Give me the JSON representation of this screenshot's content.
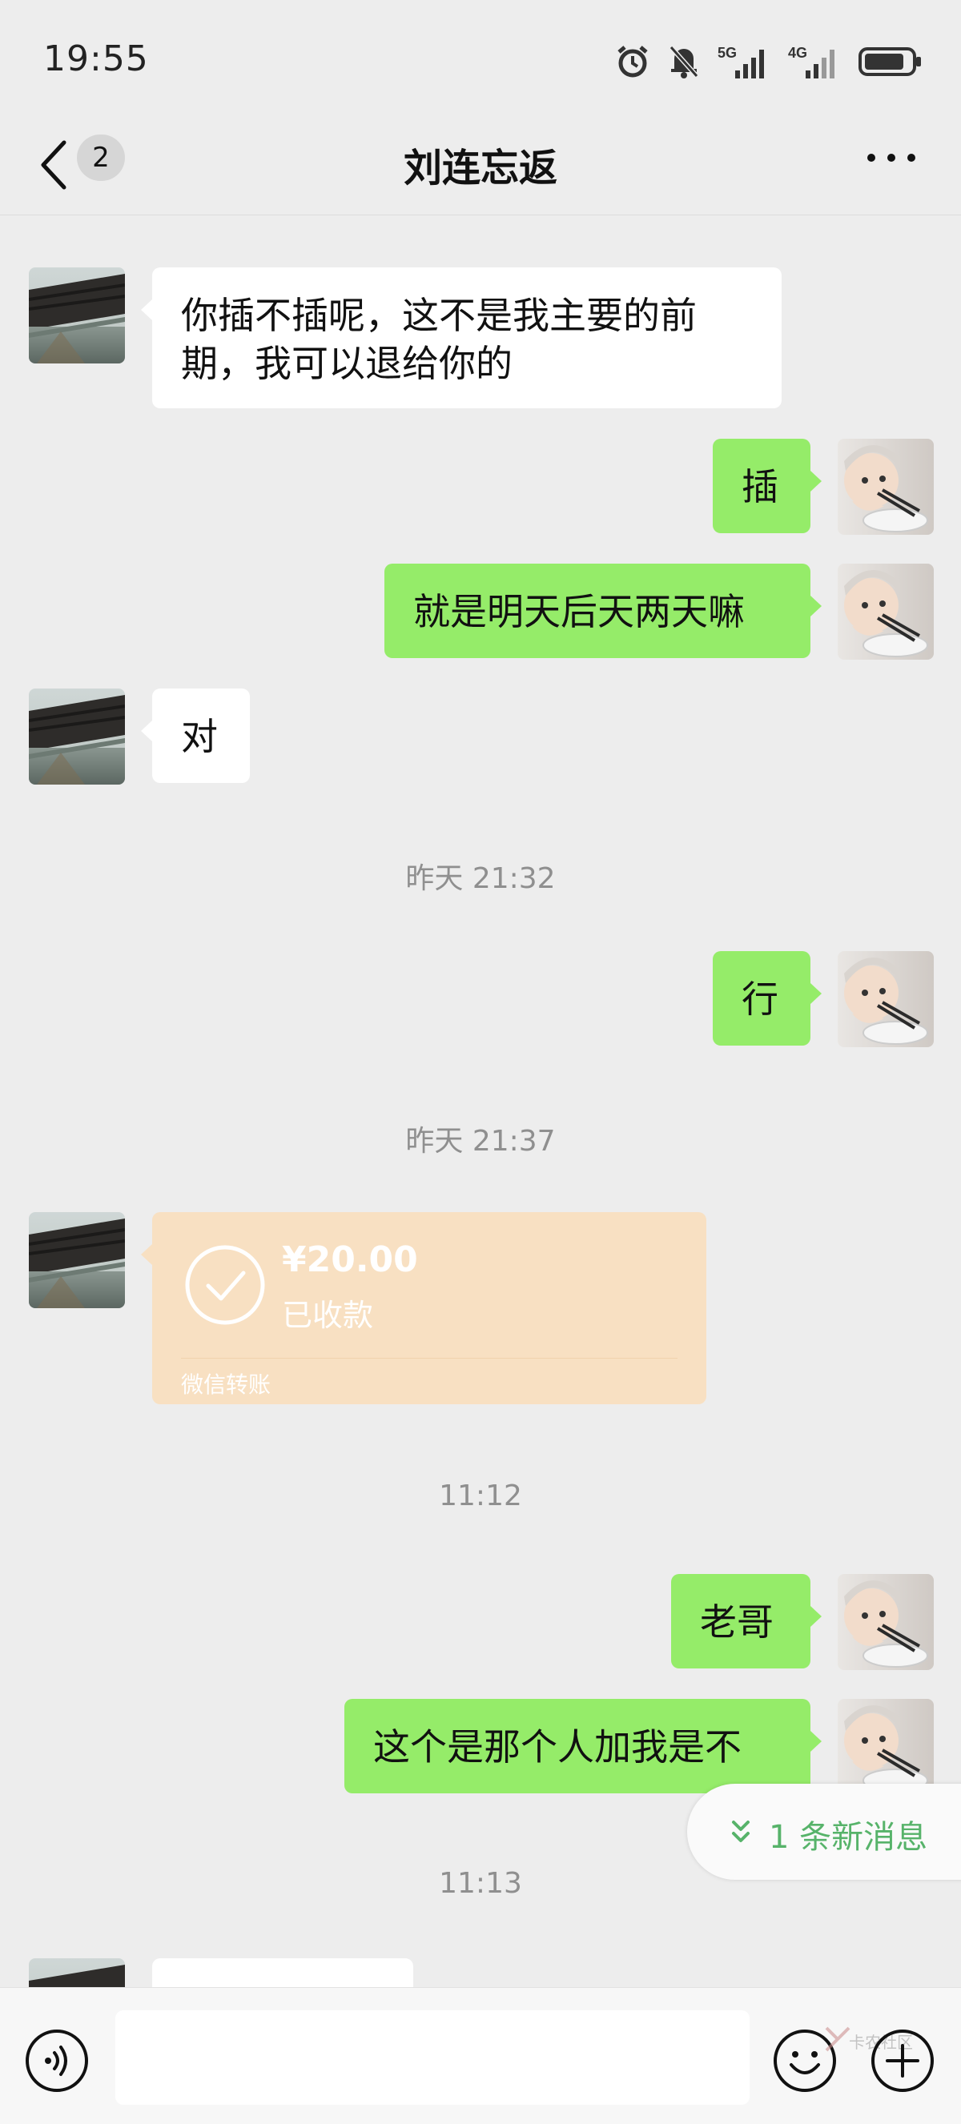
{
  "status_bar": {
    "time": "19:55",
    "icons": [
      "alarm-icon",
      "mute-icon",
      "signal-5g-icon",
      "signal-4g-icon",
      "battery-icon"
    ],
    "network_1": "5G",
    "network_2": "4G"
  },
  "header": {
    "back_icon": "chevron-left-icon",
    "unread_count": "2",
    "title": "刘连忘返",
    "more_icon": "more-icon"
  },
  "messages": [
    {
      "side": "left",
      "text": "你插不插呢，这不是我主要的前期，我可以退给你的"
    },
    {
      "side": "right",
      "text": "插"
    },
    {
      "side": "right",
      "text": "就是明天后天两天嘛"
    },
    {
      "side": "left",
      "text": "对"
    },
    {
      "type": "time",
      "text": "昨天 21:32"
    },
    {
      "side": "right",
      "text": "行"
    },
    {
      "type": "time",
      "text": "昨天 21:37"
    },
    {
      "type": "transfer",
      "side": "left",
      "amount": "¥20.00",
      "status": "已收款",
      "label": "微信转账"
    },
    {
      "type": "time",
      "text": "11:12"
    },
    {
      "side": "right",
      "text": "老哥"
    },
    {
      "side": "right",
      "text": "这个是那个人加我是不"
    },
    {
      "type": "time",
      "text": "11:13"
    }
  ],
  "new_message_pill": {
    "icon": "double-chevron-down-icon",
    "text": "1 条新消息"
  },
  "input_bar": {
    "voice_icon": "voice-icon",
    "input_value": "",
    "emoji_icon": "emoji-icon",
    "plus_icon": "plus-icon"
  },
  "watermark": {
    "text": "卡农社区"
  },
  "colors": {
    "background": "#ededed",
    "sent_bubble": "#95ec69",
    "received_bubble": "#ffffff",
    "transfer_card": "#f8e0c2",
    "accent_green": "#57b36a"
  }
}
